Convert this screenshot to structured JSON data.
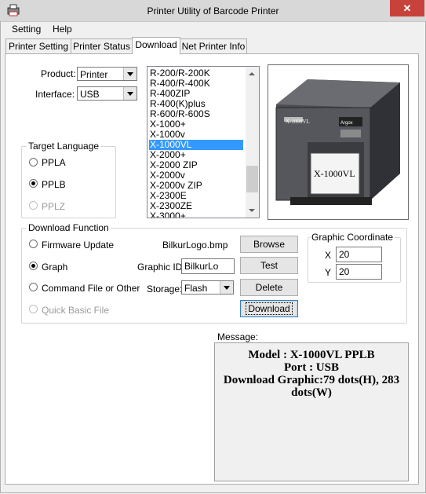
{
  "window": {
    "title": "Printer Utility of Barcode Printer",
    "close_symbol": "✕"
  },
  "menu": [
    "Setting",
    "Help"
  ],
  "tabs": [
    {
      "label": "Printer Setting"
    },
    {
      "label": "Printer Status"
    },
    {
      "label": "Download",
      "active": true
    },
    {
      "label": "Net Printer Info"
    }
  ],
  "form": {
    "product_label": "Product:",
    "product_value": "Printer",
    "interface_label": "Interface:",
    "interface_value": "USB"
  },
  "model_list": {
    "items": [
      "R-200/R-200K",
      "R-400/R-400K",
      "R-400ZIP",
      "R-400(K)plus",
      "R-600/R-600S",
      "X-1000+",
      "X-1000v",
      "X-1000VL",
      "X-2000+",
      "X-2000 ZIP",
      "X-2000v",
      "X-2000v ZIP",
      "X-2300E",
      "X-2300ZE",
      "X-3000+"
    ],
    "selected": "X-1000VL"
  },
  "printer_image": {
    "model_label": "X-1000VL",
    "paper_label": "X-1000VL",
    "brand_label": "Argox"
  },
  "target_language": {
    "title": "Target Language",
    "options": [
      {
        "label": "PPLA",
        "checked": false,
        "disabled": false
      },
      {
        "label": "PPLB",
        "checked": true,
        "disabled": false
      },
      {
        "label": "PPLZ",
        "checked": false,
        "disabled": true
      }
    ]
  },
  "download_function": {
    "title": "Download Function",
    "options": [
      {
        "label": "Firmware Update",
        "checked": false,
        "disabled": false
      },
      {
        "label": "Graph",
        "checked": true,
        "disabled": false
      },
      {
        "label": "Command File or Other",
        "checked": false,
        "disabled": false
      },
      {
        "label": "Quick Basic File",
        "checked": false,
        "disabled": true
      }
    ],
    "file_name": "BilkurLogo.bmp",
    "graphic_id_label": "Graphic ID:",
    "graphic_id_value": "BilkurLo",
    "storage_label": "Storage:",
    "storage_value": "Flash",
    "buttons": {
      "browse": "Browse",
      "test": "Test",
      "delete": "Delete",
      "download": "Download"
    }
  },
  "graphic_coordinate": {
    "title": "Graphic Coordinate",
    "x_label": "X",
    "x_value": "20",
    "y_label": "Y",
    "y_value": "20"
  },
  "message": {
    "label": "Message:",
    "lines": [
      "Model : X-1000VL PPLB",
      "Port : USB",
      "Download Graphic:79 dots(H), 283",
      "dots(W)"
    ]
  },
  "colors": {
    "selection": "#3399ff",
    "close_button": "#c7423a",
    "disabled_text": "#9a9a9a"
  }
}
